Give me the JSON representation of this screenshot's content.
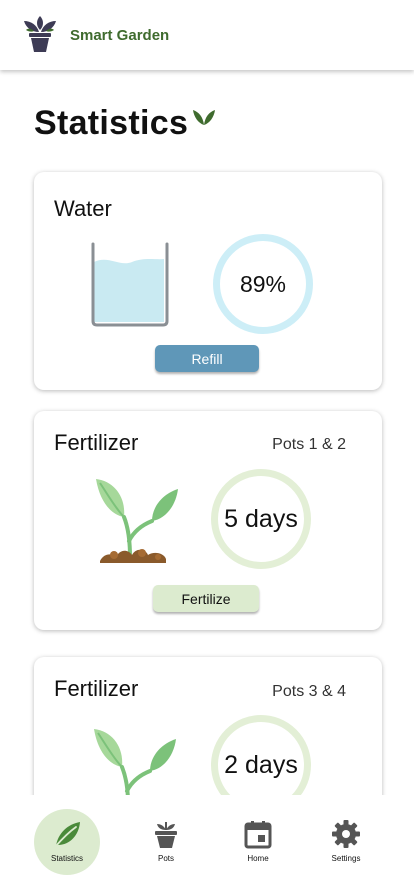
{
  "app": {
    "title": "Smart Garden",
    "logo_icon": "potted-plant-logo-icon"
  },
  "page": {
    "title": "Statistics",
    "title_icon": "leaf-sprout-icon"
  },
  "cards": {
    "water": {
      "title": "Water",
      "level_label": "89%",
      "level_percent": 89,
      "action_label": "Refill",
      "icon": "water-tank-icon"
    },
    "fertilizer_1": {
      "title": "Fertilizer",
      "pots": "Pots 1 & 2",
      "remaining_label": "5 days",
      "action_label": "Fertilize",
      "icon": "sprout-icon"
    },
    "fertilizer_2": {
      "title": "Fertilizer",
      "pots": "Pots 3 & 4",
      "remaining_label": "2 days",
      "icon": "sprout-icon"
    }
  },
  "nav": {
    "items": [
      {
        "label": "Statistics",
        "icon": "leaf-icon",
        "active": true
      },
      {
        "label": "Pots",
        "icon": "pot-icon",
        "active": false
      },
      {
        "label": "Home",
        "icon": "calendar-icon",
        "active": false
      },
      {
        "label": "Settings",
        "icon": "gear-icon",
        "active": false
      }
    ]
  },
  "colors": {
    "brand_green": "#3f6b2e",
    "water_ring": "#cdeef7",
    "fert_ring": "#e3efd6",
    "refill_button": "#5f97b8",
    "fertilize_button": "#dcebcf",
    "active_nav_bg": "#dcebcf"
  }
}
